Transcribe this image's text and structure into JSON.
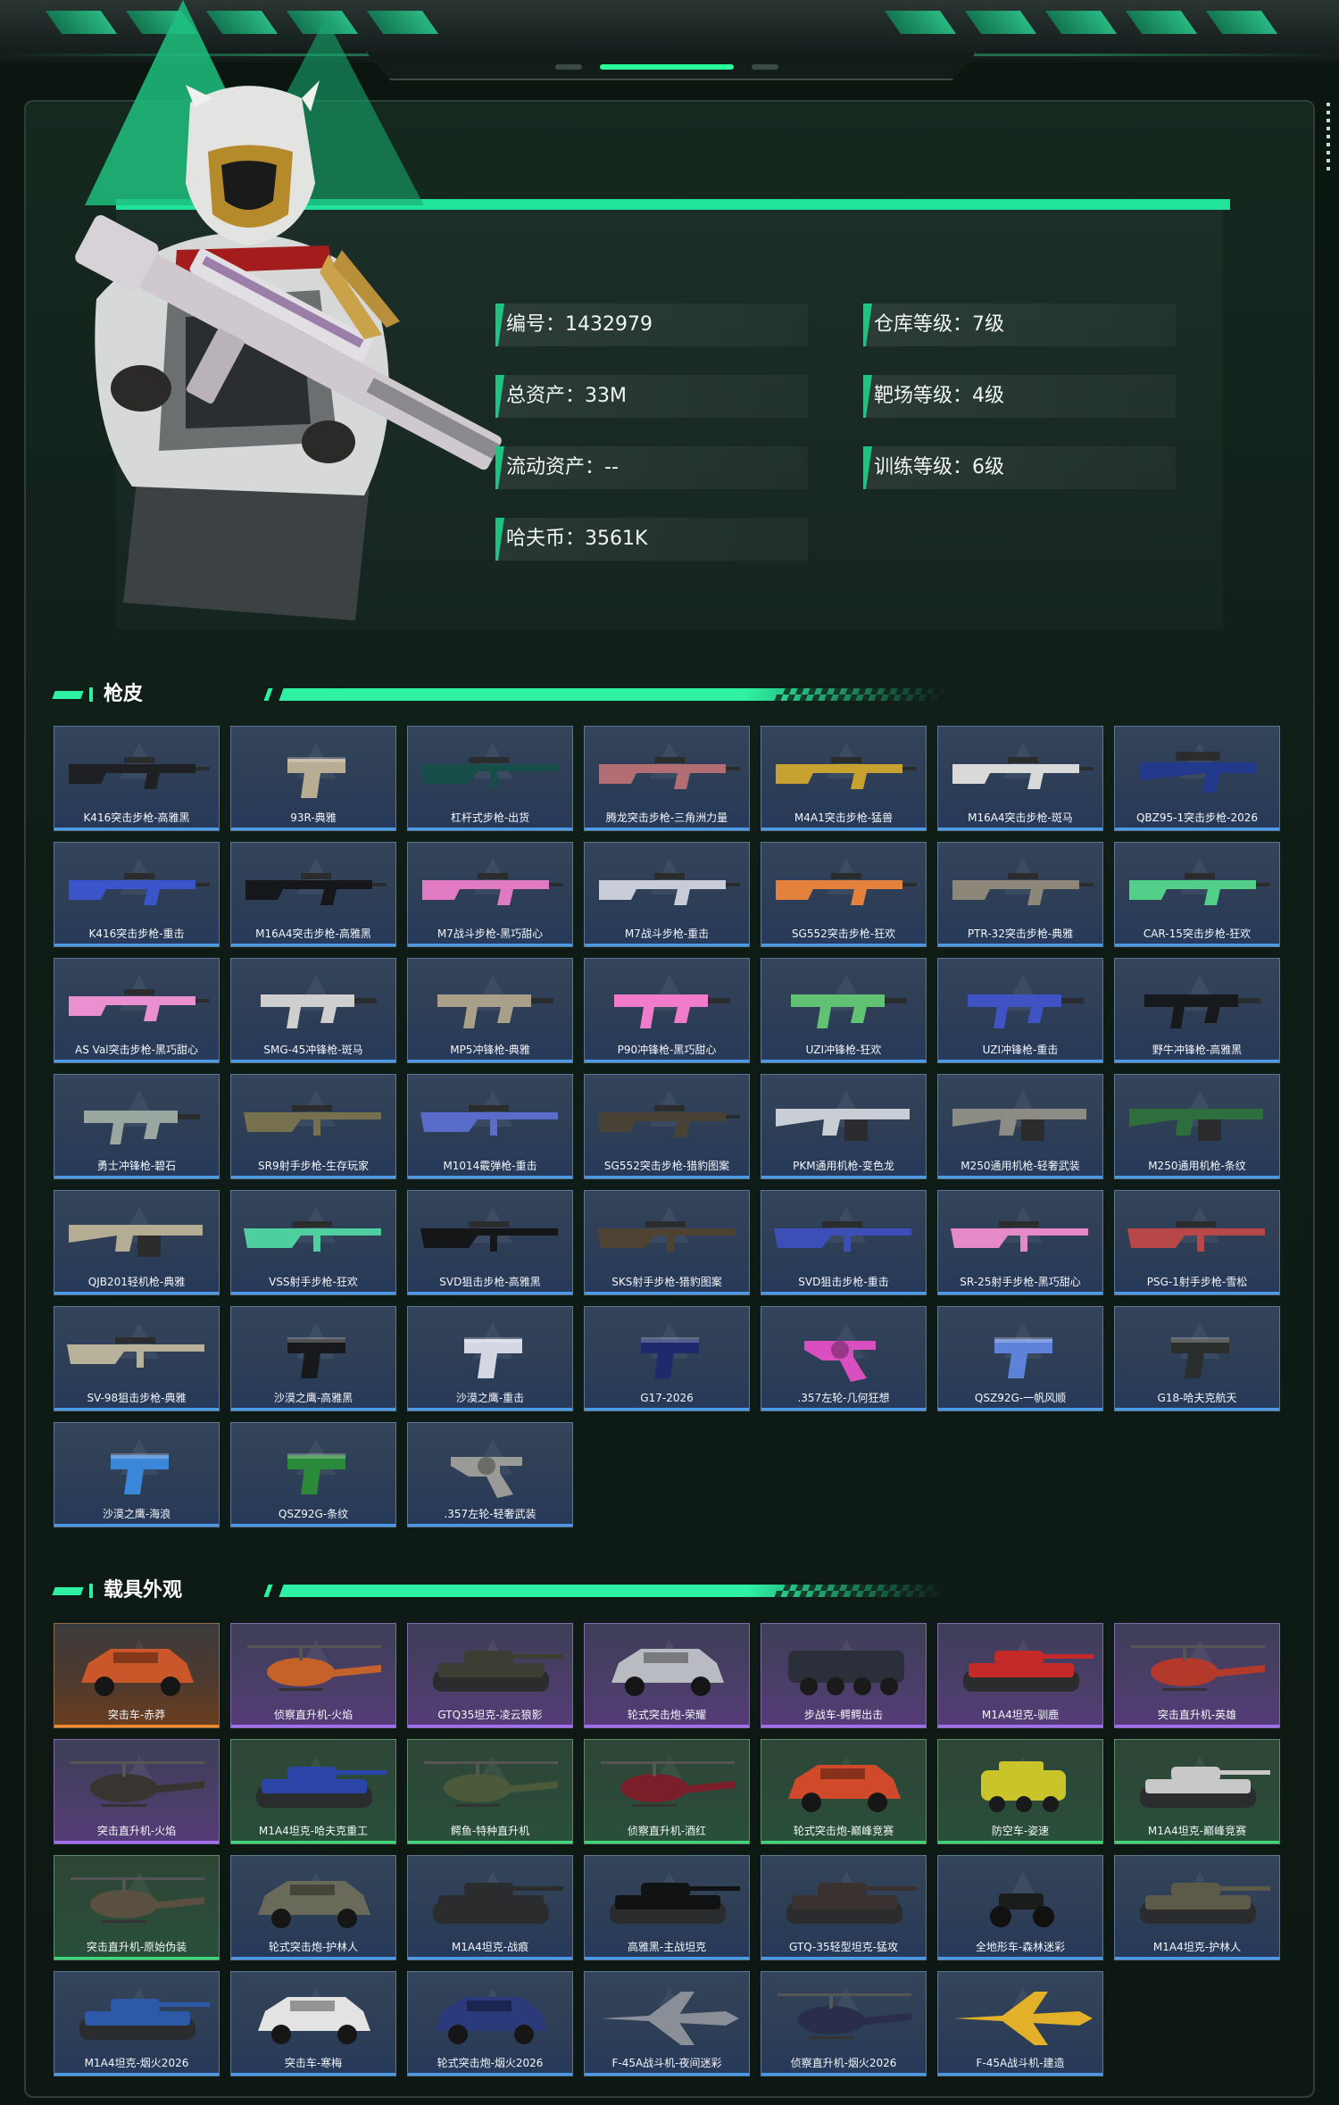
{
  "profile": {
    "id": "编号：1432979",
    "total_assets": "总资产：33M",
    "liquid_assets": "流动资产：--",
    "hafu_coin": "哈夫币：3561K",
    "warehouse_level": "仓库等级：7级",
    "range_level": "靶场等级：4级",
    "training_level": "训练等级：6级"
  },
  "sections": {
    "gun_skins_title": "枪皮",
    "vehicle_title": "载具外观"
  },
  "gun_skins": [
    {
      "label": "K416突击步枪-高雅黑",
      "rarity": "blue",
      "icon": "rifle-icon",
      "color": "#1e2024"
    },
    {
      "label": "93R-典雅",
      "rarity": "blue",
      "icon": "pistol-icon",
      "color": "#b7ad93"
    },
    {
      "label": "杠杆式步枪-出货",
      "rarity": "blue",
      "icon": "lever-rifle-icon",
      "color": "#184e4a"
    },
    {
      "label": "腾龙突击步枪-三角洲力量",
      "rarity": "blue",
      "icon": "rifle-icon",
      "color": "#b36e74"
    },
    {
      "label": "M4A1突击步枪-猛兽",
      "rarity": "blue",
      "icon": "rifle-icon",
      "color": "#c8a231"
    },
    {
      "label": "M16A4突击步枪-斑马",
      "rarity": "blue",
      "icon": "rifle-icon",
      "color": "#d9d9d9"
    },
    {
      "label": "QBZ95-1突击步枪-2026",
      "rarity": "blue",
      "icon": "bullpup-rifle-icon",
      "color": "#233a8c"
    },
    {
      "label": "K416突击步枪-重击",
      "rarity": "blue",
      "icon": "rifle-icon",
      "color": "#3a55c9"
    },
    {
      "label": "M16A4突击步枪-高雅黑",
      "rarity": "blue",
      "icon": "rifle-icon",
      "color": "#15171a"
    },
    {
      "label": "M7战斗步枪-黑巧甜心",
      "rarity": "blue",
      "icon": "rifle-icon",
      "color": "#e07ac3"
    },
    {
      "label": "M7战斗步枪-重击",
      "rarity": "blue",
      "icon": "rifle-icon",
      "color": "#c7ccd8"
    },
    {
      "label": "SG552突击步枪-狂欢",
      "rarity": "blue",
      "icon": "rifle-icon",
      "color": "#e3813d"
    },
    {
      "label": "PTR-32突击步枪-典雅",
      "rarity": "blue",
      "icon": "rifle-icon",
      "color": "#8d877a"
    },
    {
      "label": "CAR-15突击步枪-狂欢",
      "rarity": "blue",
      "icon": "rifle-icon",
      "color": "#52d08a"
    },
    {
      "label": "AS Val突击步枪-黑巧甜心",
      "rarity": "blue",
      "icon": "rifle-icon",
      "color": "#ea8fcf"
    },
    {
      "label": "SMG-45冲锋枪-斑马",
      "rarity": "blue",
      "icon": "smg-icon",
      "color": "#cfcfcf"
    },
    {
      "label": "MP5冲锋枪-典雅",
      "rarity": "blue",
      "icon": "smg-icon",
      "color": "#a8a089"
    },
    {
      "label": "P90冲锋枪-黑巧甜心",
      "rarity": "blue",
      "icon": "smg-icon",
      "color": "#f07ccb"
    },
    {
      "label": "UZI冲锋枪-狂欢",
      "rarity": "blue",
      "icon": "smg-icon",
      "color": "#62c274"
    },
    {
      "label": "UZI冲锋枪-重击",
      "rarity": "blue",
      "icon": "smg-icon",
      "color": "#3f53c4"
    },
    {
      "label": "野牛冲锋枪-高雅黑",
      "rarity": "blue",
      "icon": "smg-icon",
      "color": "#17191c"
    },
    {
      "label": "勇士冲锋枪-碧石",
      "rarity": "blue",
      "icon": "smg-icon",
      "color": "#9aa7a0"
    },
    {
      "label": "SR9射手步枪-生存玩家",
      "rarity": "blue",
      "icon": "marksman-rifle-icon",
      "color": "#77704e"
    },
    {
      "label": "M1014霰弹枪-重击",
      "rarity": "blue",
      "icon": "shotgun-icon",
      "color": "#5a6cc9"
    },
    {
      "label": "SG552突击步枪-猎豹图案",
      "rarity": "blue",
      "icon": "rifle-icon",
      "color": "#494236"
    },
    {
      "label": "PKM通用机枪-变色龙",
      "rarity": "blue",
      "icon": "machine-gun-icon",
      "color": "#c9ced6"
    },
    {
      "label": "M250通用机枪-轻奢武装",
      "rarity": "blue",
      "icon": "machine-gun-icon",
      "color": "#8c8c84"
    },
    {
      "label": "M250通用机枪-条纹",
      "rarity": "blue",
      "icon": "machine-gun-icon",
      "color": "#2d6e3c"
    },
    {
      "label": "QJB201轻机枪-典雅",
      "rarity": "blue",
      "icon": "machine-gun-icon",
      "color": "#b5ad93"
    },
    {
      "label": "VSS射手步枪-狂欢",
      "rarity": "blue",
      "icon": "marksman-rifle-icon",
      "color": "#4fcfa0"
    },
    {
      "label": "SVD狙击步枪-高雅黑",
      "rarity": "blue",
      "icon": "sniper-rifle-icon",
      "color": "#141618"
    },
    {
      "label": "SKS射手步枪-猎豹图案",
      "rarity": "blue",
      "icon": "marksman-rifle-icon",
      "color": "#4e4232"
    },
    {
      "label": "SVD狙击步枪-重击",
      "rarity": "blue",
      "icon": "sniper-rifle-icon",
      "color": "#3c4fb8"
    },
    {
      "label": "SR-25射手步枪-黑巧甜心",
      "rarity": "blue",
      "icon": "marksman-rifle-icon",
      "color": "#e58ac6"
    },
    {
      "label": "PSG-1射手步枪-雪松",
      "rarity": "blue",
      "icon": "sniper-rifle-icon",
      "color": "#b8474a"
    },
    {
      "label": "SV-98狙击步枪-典雅",
      "rarity": "blue",
      "icon": "sniper-rifle-icon",
      "color": "#b9b29a"
    },
    {
      "label": "沙漠之鹰-高雅黑",
      "rarity": "blue",
      "icon": "pistol-icon",
      "color": "#18191c"
    },
    {
      "label": "沙漠之鹰-重击",
      "rarity": "blue",
      "icon": "pistol-icon",
      "color": "#d3d7e3"
    },
    {
      "label": "G17-2026",
      "rarity": "blue",
      "icon": "pistol-icon",
      "color": "#1d2a6b"
    },
    {
      "label": ".357左轮-几何狂想",
      "rarity": "blue",
      "icon": "revolver-icon",
      "color": "#d94fc0"
    },
    {
      "label": "QSZ92G-一帆风顺",
      "rarity": "blue",
      "icon": "pistol-icon",
      "color": "#5d82d8"
    },
    {
      "label": "G18-哈夫克航天",
      "rarity": "blue",
      "icon": "pistol-icon",
      "color": "#2a2e2d"
    },
    {
      "label": "沙漠之鹰-海浪",
      "rarity": "blue",
      "icon": "pistol-icon",
      "color": "#3a86d9"
    },
    {
      "label": "QSZ92G-条纹",
      "rarity": "blue",
      "icon": "pistol-icon",
      "color": "#2a8a3a"
    },
    {
      "label": ".357左轮-轻奢武装",
      "rarity": "blue",
      "icon": "revolver-icon",
      "color": "#9a9a96"
    }
  ],
  "vehicles": [
    {
      "label": "突击车-赤莽",
      "rarity": "orange",
      "icon": "armored-car-icon",
      "color": "#c9572a"
    },
    {
      "label": "侦察直升机-火焰",
      "rarity": "purple",
      "icon": "helicopter-icon",
      "color": "#c4622a"
    },
    {
      "label": "GTQ35坦克-凌云狼影",
      "rarity": "purple",
      "icon": "tank-icon",
      "color": "#3b3f33"
    },
    {
      "label": "轮式突击炮-荣耀",
      "rarity": "purple",
      "icon": "armored-car-icon",
      "color": "#b8bcc2"
    },
    {
      "label": "步战车-鳄鳄出击",
      "rarity": "purple",
      "icon": "apc-icon",
      "color": "#2a2f3a"
    },
    {
      "label": "M1A4坦克-驯鹿",
      "rarity": "purple",
      "icon": "tank-icon",
      "color": "#c42a2a"
    },
    {
      "label": "突击直升机-英雄",
      "rarity": "purple",
      "icon": "helicopter-icon",
      "color": "#b33a2a"
    },
    {
      "label": "突击直升机-火焰",
      "rarity": "purple",
      "icon": "helicopter-icon",
      "color": "#3a3430"
    },
    {
      "label": "M1A4坦克-哈夫克重工",
      "rarity": "green",
      "icon": "tank-icon",
      "color": "#2a44a8"
    },
    {
      "label": "鳄鱼-特种直升机",
      "rarity": "green",
      "icon": "helicopter-icon",
      "color": "#4a5a3a"
    },
    {
      "label": "侦察直升机-酒红",
      "rarity": "green",
      "icon": "helicopter-icon",
      "color": "#7a1f2a"
    },
    {
      "label": "轮式突击炮-巅峰竞赛",
      "rarity": "green",
      "icon": "armored-car-icon",
      "color": "#d04a2a"
    },
    {
      "label": "防空车-姿速",
      "rarity": "green",
      "icon": "anti-air-vehicle-icon",
      "color": "#c8c42a"
    },
    {
      "label": "M1A4坦克-巅峰竞赛",
      "rarity": "green",
      "icon": "tank-icon",
      "color": "#c8c8c8"
    },
    {
      "label": "突击直升机-原始伪装",
      "rarity": "green",
      "icon": "helicopter-icon",
      "color": "#5a5040"
    },
    {
      "label": "轮式突击炮-护林人",
      "rarity": "blue",
      "icon": "armored-car-icon",
      "color": "#6a6a5a"
    },
    {
      "label": "M1A4坦克-战痕",
      "rarity": "blue",
      "icon": "tank-icon",
      "color": "#2a2c2e"
    },
    {
      "label": "高雅黑-主战坦克",
      "rarity": "blue",
      "icon": "tank-icon",
      "color": "#111214"
    },
    {
      "label": "GTQ-35轻型坦克-猛攻",
      "rarity": "blue",
      "icon": "tank-icon",
      "color": "#3a3230"
    },
    {
      "label": "全地形车-森林迷彩",
      "rarity": "blue",
      "icon": "atv-icon",
      "color": "#1a1d1c"
    },
    {
      "label": "M1A4坦克-护林人",
      "rarity": "blue",
      "icon": "tank-icon",
      "color": "#5c5a48"
    },
    {
      "label": "M1A4坦克-烟火2026",
      "rarity": "blue",
      "icon": "tank-icon",
      "color": "#2c5aa8"
    },
    {
      "label": "突击车-寒梅",
      "rarity": "blue",
      "icon": "armored-car-icon",
      "color": "#e3e3e3"
    },
    {
      "label": "轮式突击炮-烟火2026",
      "rarity": "blue",
      "icon": "armored-car-icon",
      "color": "#2a3a7a"
    },
    {
      "label": "F-45A战斗机-夜间迷彩",
      "rarity": "blue",
      "icon": "jet-icon",
      "color": "#8a8e96"
    },
    {
      "label": "侦察直升机-烟火2026",
      "rarity": "blue",
      "icon": "helicopter-icon",
      "color": "#2a2e4a"
    },
    {
      "label": "F-45A战斗机-建造",
      "rarity": "blue",
      "icon": "jet-icon",
      "color": "#e3b02a"
    }
  ],
  "colors": {
    "accent": "#22e39a",
    "rarity_blue": "#4a9ae8",
    "rarity_purple": "#a46ef0",
    "rarity_green": "#3fd67a",
    "rarity_orange": "#f08a2a"
  }
}
